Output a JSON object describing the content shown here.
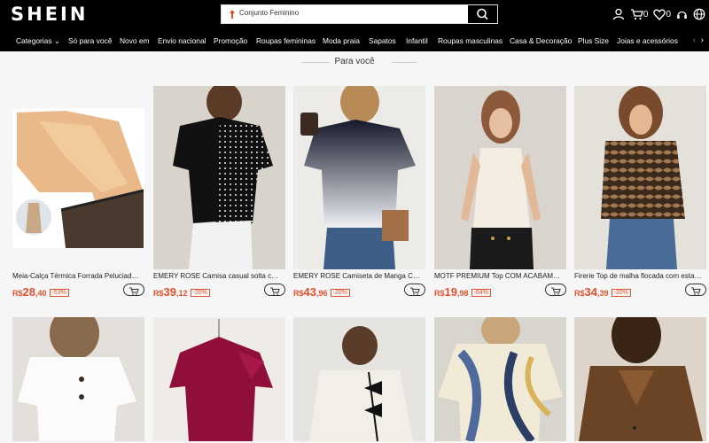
{
  "header": {
    "logo": "SHEIN",
    "search_query": "Conjunto Feminino",
    "cart_count": "0",
    "wishlist_count": "0"
  },
  "nav": {
    "items": [
      "Categorias",
      "Só para você",
      "Novo em",
      "Envio nacional",
      "Promoção",
      "Roupas femininas",
      "Moda praia",
      "Sapatos",
      "Infantil",
      "Roupas masculinas",
      "Casa & Decoração",
      "Plus Size",
      "Joias e acessórios"
    ]
  },
  "section": {
    "title": "Para você"
  },
  "products": [
    {
      "name": "Meia-Calça Térmica Forrada Peluciad…",
      "cur": "R$",
      "int": "28",
      "dec": ",40",
      "discount": "-53%"
    },
    {
      "name": "EMERY ROSE Camisa casual solta c…",
      "cur": "R$",
      "int": "39",
      "dec": ",12",
      "discount": "-20%"
    },
    {
      "name": "EMERY ROSE Camiseta de Manga C…",
      "cur": "R$",
      "int": "43",
      "dec": ",96",
      "discount": "-20%"
    },
    {
      "name": "MOTF PREMIUM Top COM ACABAM…",
      "cur": "R$",
      "int": "19",
      "dec": ",98",
      "discount": "-64%"
    },
    {
      "name": "Firerie Top de malha flocada com esta…",
      "cur": "R$",
      "int": "34",
      "dec": ",39",
      "discount": "-20%"
    }
  ],
  "colors": {
    "accent": "#e0522d",
    "header_bg": "#000000"
  }
}
